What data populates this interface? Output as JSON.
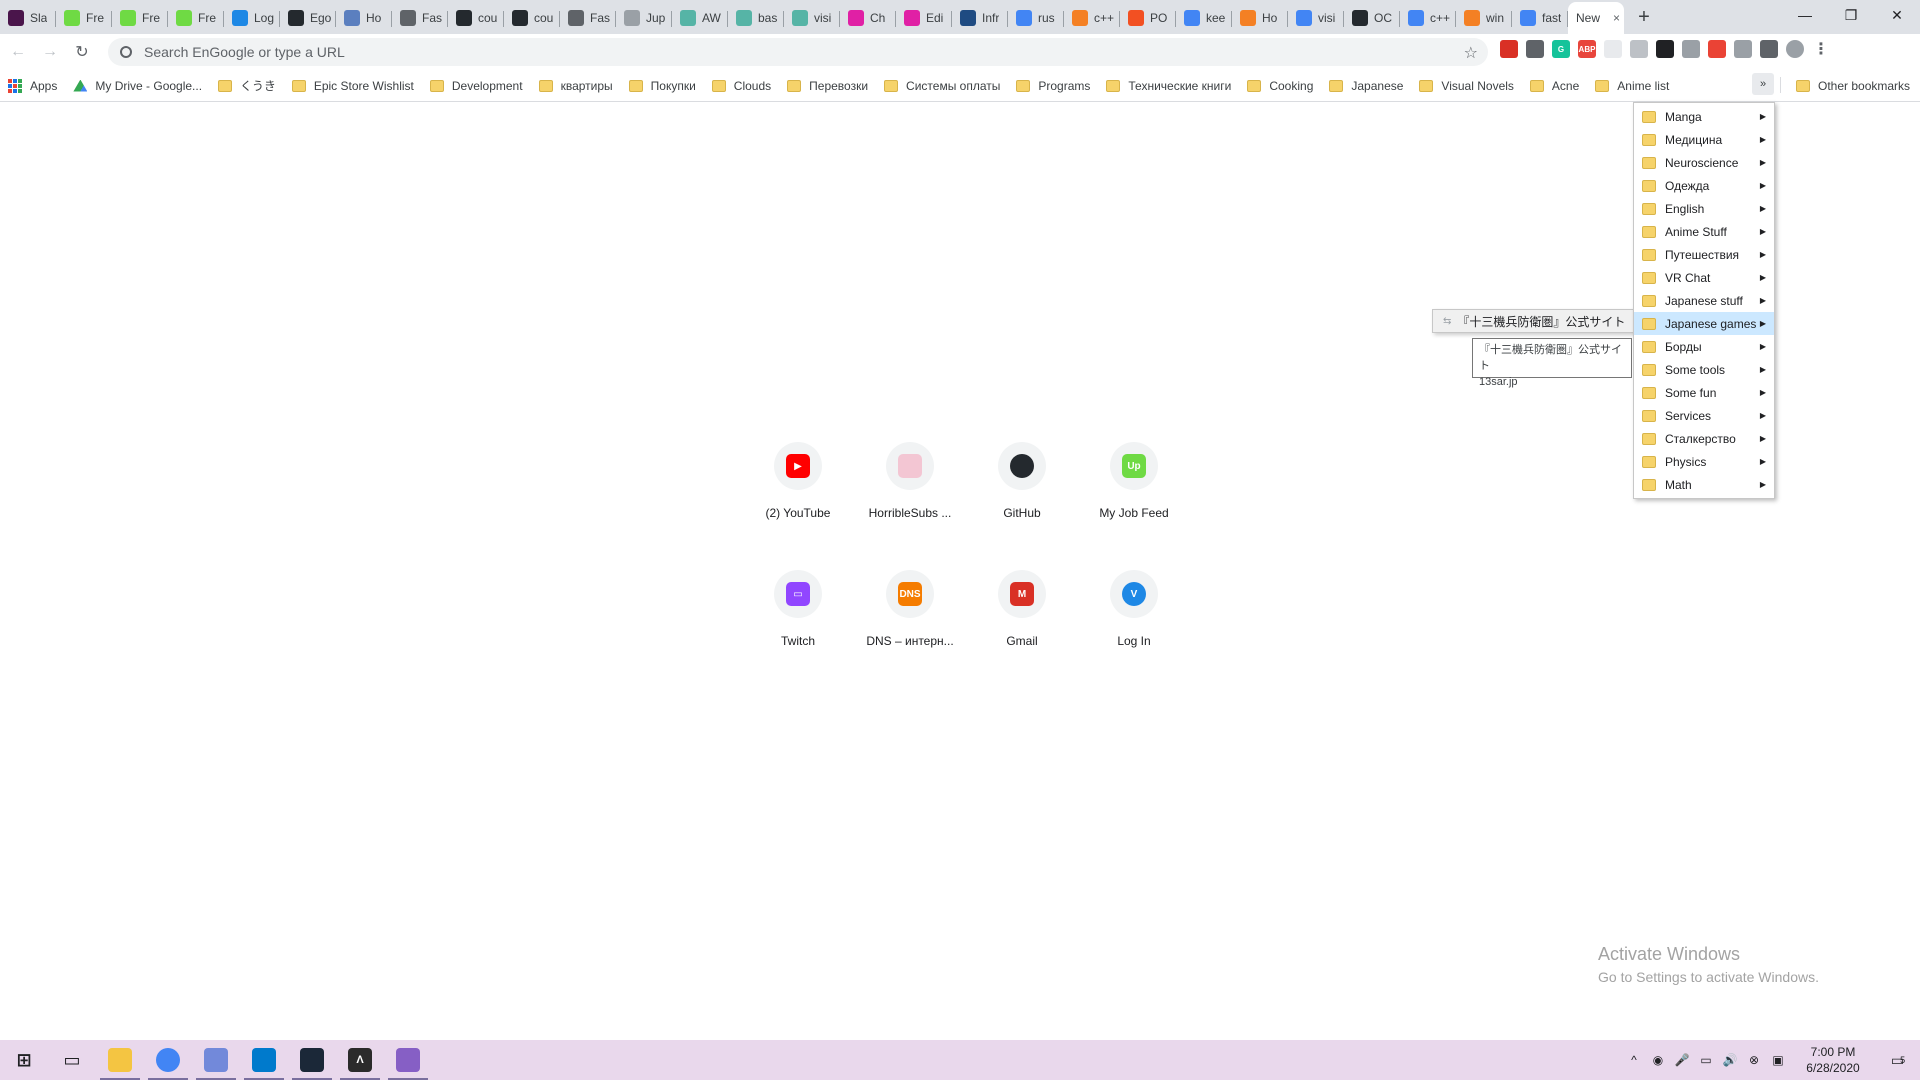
{
  "tabs": [
    {
      "title": "Sla",
      "icon": "slack-icon",
      "color": "#4a154b"
    },
    {
      "title": "Fre",
      "icon": "upwork-icon",
      "color": "#6fda44"
    },
    {
      "title": "Fre",
      "icon": "upwork-icon",
      "color": "#6fda44"
    },
    {
      "title": "Fre",
      "icon": "upwork-icon",
      "color": "#6fda44"
    },
    {
      "title": "Log",
      "icon": "vultr-icon",
      "color": "#1e88e5"
    },
    {
      "title": "Ego",
      "icon": "github-icon",
      "color": "#24292e"
    },
    {
      "title": "Ho",
      "icon": "globe-icon",
      "color": "#5b7fbf"
    },
    {
      "title": "Fas",
      "icon": "globe-icon",
      "color": "#5f6368"
    },
    {
      "title": "cou",
      "icon": "github-icon",
      "color": "#24292e"
    },
    {
      "title": "cou",
      "icon": "github-icon",
      "color": "#24292e"
    },
    {
      "title": "Fas",
      "icon": "globe-icon",
      "color": "#5f6368"
    },
    {
      "title": "Jup",
      "icon": "jupyter-icon",
      "color": "#9aa0a6"
    },
    {
      "title": "AW",
      "icon": "doc-icon",
      "color": "#56b4a6"
    },
    {
      "title": "bas",
      "icon": "doc-icon",
      "color": "#56b4a6"
    },
    {
      "title": "visi",
      "icon": "doc-icon",
      "color": "#56b4a6"
    },
    {
      "title": "Ch",
      "icon": "pink-app-icon",
      "color": "#e020a5"
    },
    {
      "title": "Edi",
      "icon": "pink-app-icon",
      "color": "#e020a5"
    },
    {
      "title": "Infr",
      "icon": "chart-app-icon",
      "color": "#1f4b82"
    },
    {
      "title": "rus",
      "icon": "google-icon",
      "color": "#4285f4"
    },
    {
      "title": "c++",
      "icon": "stackoverflow-icon",
      "color": "#f48024"
    },
    {
      "title": "PO",
      "icon": "microsoft-icon",
      "color": "#f25022"
    },
    {
      "title": "kee",
      "icon": "google-icon",
      "color": "#4285f4"
    },
    {
      "title": "Ho",
      "icon": "stackoverflow-icon",
      "color": "#f48024"
    },
    {
      "title": "visi",
      "icon": "google-icon",
      "color": "#4285f4"
    },
    {
      "title": "OC",
      "icon": "github-icon",
      "color": "#24292e"
    },
    {
      "title": "c++",
      "icon": "google-icon",
      "color": "#4285f4"
    },
    {
      "title": "win",
      "icon": "stackoverflow-icon",
      "color": "#f48024"
    },
    {
      "title": "fast",
      "icon": "google-icon",
      "color": "#4285f4"
    }
  ],
  "active_tab": {
    "title": "New",
    "close": "×"
  },
  "new_tab": "+",
  "window": {
    "minimize": "—",
    "maximize": "❐",
    "close": "✕"
  },
  "toolbar": {
    "back": "←",
    "forward": "→",
    "reload": "↻",
    "omnibox_placeholder": "Search EnGoogle or type a URL",
    "star": "☆",
    "extensions": [
      {
        "name": "red-book-extension-icon",
        "color": "#d93025",
        "glyph": ""
      },
      {
        "name": "store-extension-icon",
        "color": "#5f6368",
        "glyph": ""
      },
      {
        "name": "grammarly-extension-icon",
        "color": "#15c39a",
        "glyph": "G"
      },
      {
        "name": "adblock-extension-icon",
        "color": "#e8453c",
        "glyph": "ABP"
      },
      {
        "name": "blank-extension-icon",
        "color": "#e8eaed",
        "glyph": ""
      },
      {
        "name": "gauge-extension-icon",
        "color": "#bdc1c6",
        "glyph": ""
      },
      {
        "name": "table-extension-icon",
        "color": "#202124",
        "glyph": ""
      },
      {
        "name": "cast-extension-icon",
        "color": "#9aa0a6",
        "glyph": ""
      },
      {
        "name": "ring-extension-icon",
        "color": "#ea4335",
        "glyph": ""
      },
      {
        "name": "vr-extension-icon",
        "color": "#9aa0a6",
        "glyph": ""
      },
      {
        "name": "puzzle-extension-icon",
        "color": "#5f6368",
        "glyph": ""
      },
      {
        "name": "profile-avatar-icon",
        "color": "#9aa0a6",
        "glyph": ""
      },
      {
        "name": "kebab-menu-icon",
        "color": "#ffffff",
        "glyph": "⋮"
      }
    ]
  },
  "bookmarks": {
    "apps": "Apps",
    "drive": "My Drive - Google...",
    "folders": [
      "くうき",
      "Epic Store Wishlist",
      "Development",
      "квартиры",
      "Покупки",
      "Clouds",
      "Перевозки",
      "Системы оплаты",
      "Programs",
      "Технические книги",
      "Cooking",
      "Japanese",
      "Visual Novels",
      "Acne",
      "Anime list"
    ],
    "chevron": "»",
    "other": "Other bookmarks"
  },
  "overflow_menu": {
    "items": [
      "Manga",
      "Медицина",
      "Neuroscience",
      "Одежда",
      "English",
      "Anime Stuff",
      "Путешествия",
      "VR Chat",
      "Japanese stuff",
      "Japanese games",
      "Борды",
      "Some tools",
      "Some fun",
      "Services",
      "Сталкерство",
      "Physics",
      "Math"
    ],
    "highlighted": "Japanese games"
  },
  "submenu": {
    "link": "『十三機兵防衛圏』公式サイト"
  },
  "tooltip": {
    "title": "『十三機兵防衛圏』公式サイト",
    "url": "13sar.jp"
  },
  "shortcuts": [
    {
      "label": "(2) YouTube",
      "icon": "youtube-icon",
      "color": "#ff0000",
      "glyph": "▶"
    },
    {
      "label": "HorribleSubs ...",
      "icon": "horriblesubs-icon",
      "color": "#f3c6d3",
      "glyph": ""
    },
    {
      "label": "GitHub",
      "icon": "github-icon",
      "color": "#24292e",
      "glyph": ""
    },
    {
      "label": "My Job Feed",
      "icon": "upwork-icon",
      "color": "#6fda44",
      "glyph": "Up"
    },
    {
      "label": "Twitch",
      "icon": "twitch-icon",
      "color": "#9146ff",
      "glyph": "▭"
    },
    {
      "label": "DNS – интерн...",
      "icon": "dns-icon",
      "color": "#f57c00",
      "glyph": "DNS"
    },
    {
      "label": "Gmail",
      "icon": "gmail-icon",
      "color": "#d93025",
      "glyph": "M"
    },
    {
      "label": "Log In",
      "icon": "vultr-icon",
      "color": "#1e88e5",
      "glyph": "V"
    }
  ],
  "watermark": {
    "line1": "Activate Windows",
    "line2": "Go to Settings to activate Windows."
  },
  "taskbar": {
    "apps": [
      {
        "name": "windows-start-icon",
        "color": "#202124",
        "glyph": "⊞",
        "running": false
      },
      {
        "name": "task-view-icon",
        "color": "#202124",
        "glyph": "▭",
        "running": false
      },
      {
        "name": "file-explorer-icon",
        "color": "#f4c542",
        "glyph": "",
        "running": true
      },
      {
        "name": "chrome-icon",
        "color": "#4285f4",
        "glyph": "",
        "running": true
      },
      {
        "name": "discord-icon",
        "color": "#7289da",
        "glyph": "",
        "running": true
      },
      {
        "name": "vscode-icon",
        "color": "#007acc",
        "glyph": "",
        "running": true
      },
      {
        "name": "steam-icon",
        "color": "#1b2838",
        "glyph": "",
        "running": true
      },
      {
        "name": "unreal-icon",
        "color": "#2b2b2b",
        "glyph": "Λ",
        "running": true
      },
      {
        "name": "visual-studio-icon",
        "color": "#865fc5",
        "glyph": "",
        "running": true
      }
    ],
    "tray": [
      "^",
      "◉",
      "🎤",
      "▭",
      "🔊",
      "⊗",
      "▣"
    ],
    "time": "7:00 PM",
    "date": "6/28/2020",
    "notifications": "5"
  }
}
